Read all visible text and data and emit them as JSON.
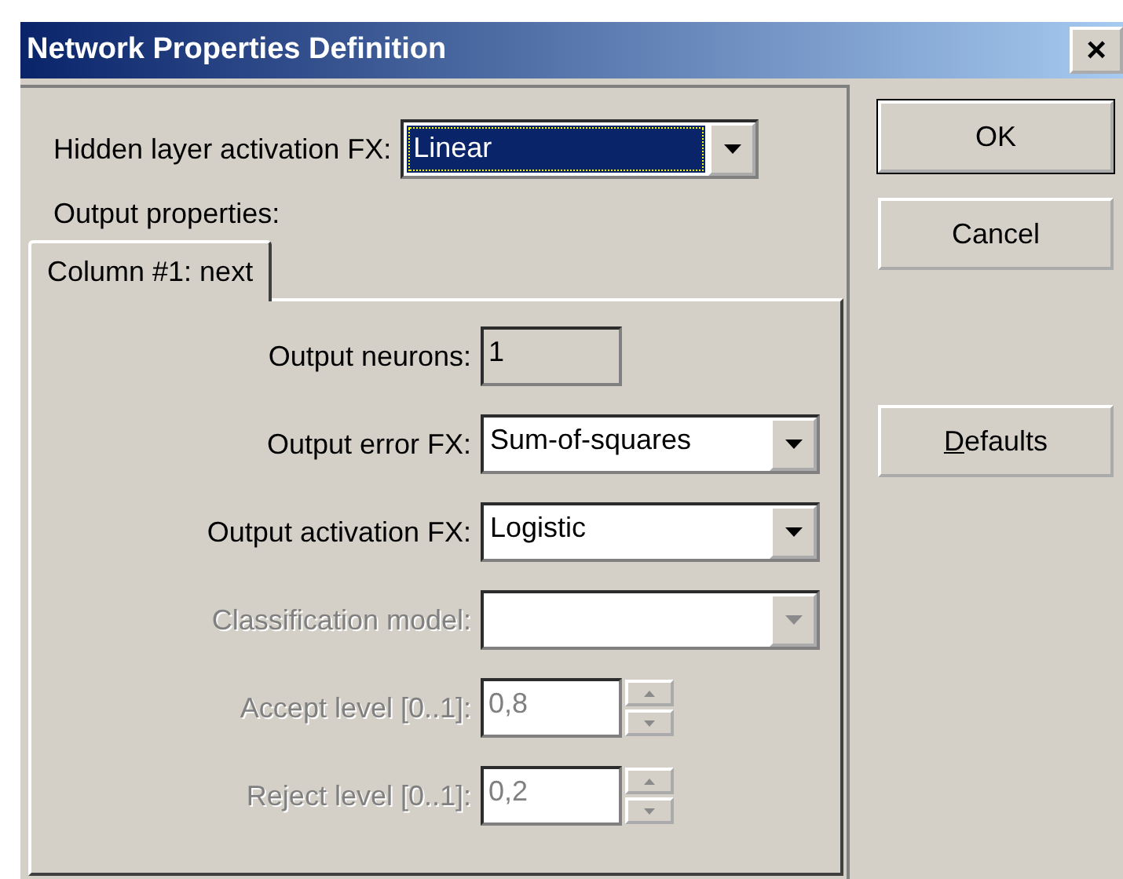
{
  "window": {
    "title": "Network Properties Definition",
    "close": "×"
  },
  "hidden_activation": {
    "label": "Hidden layer activation FX:",
    "value": "Linear",
    "focused": true
  },
  "output_properties": "Output properties:",
  "tabs": [
    {
      "label": "Column #1: next",
      "selected": true
    }
  ],
  "fields": [
    {
      "kind": "text",
      "label": "Output neurons:",
      "value": "1",
      "disabled": false,
      "readonly": true
    },
    {
      "kind": "dropdown",
      "label": "Output error FX:",
      "value": "Sum-of-squares",
      "disabled": false
    },
    {
      "kind": "dropdown",
      "label": "Output activation FX:",
      "value": "Logistic",
      "disabled": false
    },
    {
      "kind": "dropdown",
      "label": "Classification model:",
      "disabled": true
    },
    {
      "kind": "spinner",
      "label": "Accept level [0..1]:",
      "value": "0,8",
      "disabled": true
    },
    {
      "kind": "spinner",
      "label": "Reject level [0..1]:",
      "value": "0,2",
      "disabled": true
    }
  ],
  "buttons": [
    {
      "label": "OK",
      "default": true,
      "first_letter_underlined": false
    },
    {
      "label": "Cancel",
      "default": false,
      "first_letter_underlined": false
    },
    {
      "label": "Defaults",
      "default": false,
      "first_letter_underlined": true
    }
  ]
}
